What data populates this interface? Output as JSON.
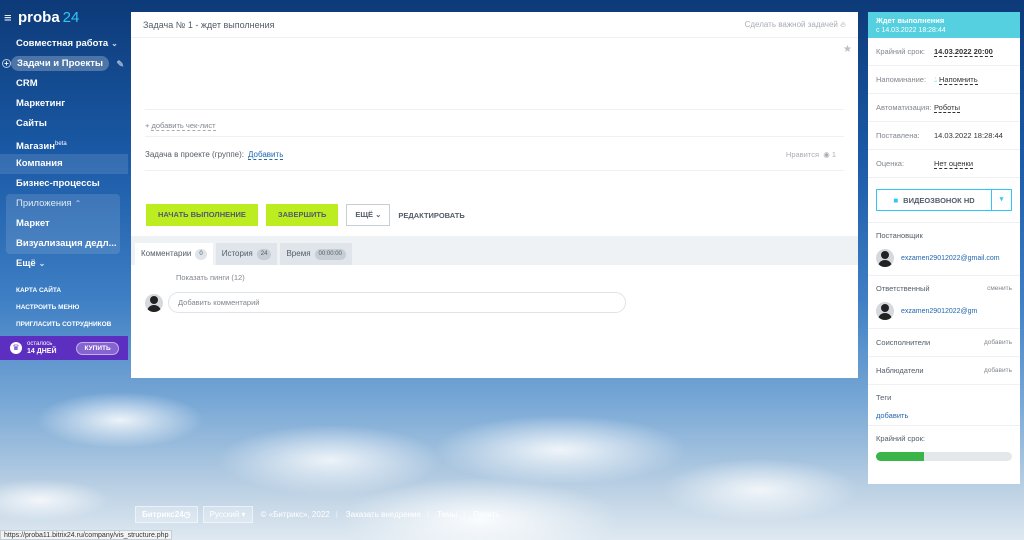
{
  "app": {
    "logo_text": "proba",
    "logo_num": "24"
  },
  "sidebar": {
    "items": [
      {
        "label": "Совместная работа",
        "chev": "⌄"
      },
      {
        "label": "Задачи и Проекты"
      },
      {
        "label": "CRM"
      },
      {
        "label": "Маркетинг"
      },
      {
        "label": "Сайты"
      },
      {
        "label": "Магазин",
        "sup": "beta"
      },
      {
        "label": "Компания"
      },
      {
        "label": "Бизнес-процессы"
      }
    ],
    "apps_head": "Приложения",
    "apps_items": [
      "Маркет",
      "Визуализация дедл..."
    ],
    "more": "Ещё",
    "links": [
      "КАРТА САЙТА",
      "НАСТРОИТЬ МЕНЮ",
      "ПРИГЛАСИТЬ СОТРУДНИКОВ"
    ],
    "trial": {
      "line1": "осталось",
      "line2": "14 ДНЕЙ",
      "buy": "КУПИТЬ"
    }
  },
  "task": {
    "title": "Задача № 1 - ждет выполнения",
    "important": "Сделать важной задачей",
    "checklist": "добавить чек-лист",
    "project_label": "Задача в проекте (группе):",
    "project_add": "Добавить",
    "likes": "Нравится",
    "likes_count": "1",
    "btn_start": "НАЧАТЬ ВЫПОЛНЕНИЕ",
    "btn_finish": "ЗАВЕРШИТЬ",
    "btn_more": "ЕЩЁ",
    "btn_edit": "РЕДАКТИРОВАТЬ",
    "tabs": [
      {
        "label": "Комментарии",
        "count": "0"
      },
      {
        "label": "История",
        "count": "24"
      },
      {
        "label": "Время",
        "count": "00:00:00"
      }
    ],
    "pings": "Показать пинги (12)",
    "comment_placeholder": "Добавить комментарий"
  },
  "right": {
    "status": "Ждет выполнения",
    "status_since": "с 14.03.2022 18:28:44",
    "rows": [
      {
        "label": "Крайний срок:",
        "value": "14.03.2022 20:00"
      },
      {
        "label": "Напоминание:",
        "value": "Напомнить"
      },
      {
        "label": "Автоматизация:",
        "value": "Роботы"
      },
      {
        "label": "Поставлена:",
        "value": "14.03.2022 18:28:44"
      },
      {
        "label": "Оценка:",
        "value": "Нет оценки"
      }
    ],
    "video": "ВИДЕОЗВОНОК HD",
    "creator_title": "Постановщик",
    "creator_email": "exzamen29012022@gmail.com",
    "responsible_title": "Ответственный",
    "responsible_action": "сменить",
    "responsible_email": "exzamen29012022@gm",
    "coexec_title": "Соисполнители",
    "coexec_action": "добавить",
    "observers_title": "Наблюдатели",
    "observers_action": "добавить",
    "tags_title": "Теги",
    "tags_add": "добавить",
    "deadline_title": "Крайний срок:",
    "deadline_progress": 0.35
  },
  "footer": {
    "badge": "Битрикс24",
    "lang": "Русский",
    "copyright": "© «Битрикс», 2022",
    "order": "Заказать внедрение",
    "themes": "Темы",
    "print": "Печать"
  },
  "statusbar": "https://proba11.bitrix24.ru/company/vis_structure.php",
  "colors": {
    "accent": "#2fc6f6",
    "green_btn": "#bbed21",
    "status_head": "#55d0e0",
    "trial_bg": "#5d2fc1",
    "progress": "#3bb54a"
  }
}
